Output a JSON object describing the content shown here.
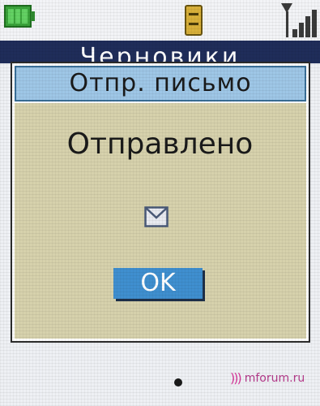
{
  "status_bar": {
    "battery_icon": "battery-full-icon",
    "memory_icon": "memory-card-icon",
    "signal_icon": "signal-strength-icon"
  },
  "screen": {
    "title": "Черновики"
  },
  "dialog": {
    "title": "Отпр. письмо",
    "message": "Отправлено",
    "icon": "envelope-icon",
    "ok_label": "OK"
  },
  "watermark": {
    "text": "mforum.ru"
  },
  "colors": {
    "title_bar": "#1f2d5a",
    "dialog_header": "#9ec6e6",
    "dialog_body": "#d6d1ac",
    "ok_button": "#3f8fcf",
    "battery": "#3aa23a"
  }
}
